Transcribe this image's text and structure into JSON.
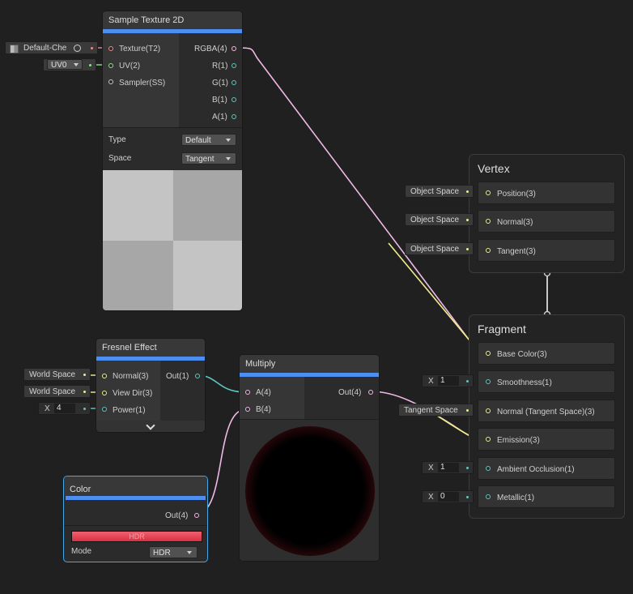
{
  "colors": {
    "background": "#202020",
    "accent_bar": "#4c8ff0",
    "texture_port": "#f08888",
    "uv_port": "#8fe08a",
    "vector1_port": "#5fc6c0",
    "vector3_port": "#f0ee8a",
    "vector4_port": "#f0b8e6",
    "hdr_color": "#e04a58"
  },
  "sample_texture": {
    "title": "Sample Texture 2D",
    "inputs": [
      "Texture(T2)",
      "UV(2)",
      "Sampler(SS)"
    ],
    "outputs": [
      "RGBA(4)",
      "R(1)",
      "G(1)",
      "B(1)",
      "A(1)"
    ],
    "type_label": "Type",
    "type_value": "Default",
    "space_label": "Space",
    "space_value": "Tangent",
    "texture_chip": "Default-Che",
    "uv_chip": "UV0"
  },
  "fresnel": {
    "title": "Fresnel Effect",
    "inputs": [
      "Normal(3)",
      "View Dir(3)",
      "Power(1)"
    ],
    "output": "Out(1)",
    "normal_chip": "World Space",
    "viewdir_chip": "World Space",
    "power_label": "X",
    "power_value": "4"
  },
  "multiply": {
    "title": "Multiply",
    "inputs": [
      "A(4)",
      "B(4)"
    ],
    "output": "Out(4)"
  },
  "color_node": {
    "title": "Color",
    "output": "Out(4)",
    "swatch_label": "HDR",
    "mode_label": "Mode",
    "mode_value": "HDR"
  },
  "vertex": {
    "title": "Vertex",
    "slots": [
      {
        "label": "Position(3)",
        "chip": "Object Space"
      },
      {
        "label": "Normal(3)",
        "chip": "Object Space"
      },
      {
        "label": "Tangent(3)",
        "chip": "Object Space"
      }
    ]
  },
  "fragment": {
    "title": "Fragment",
    "slots": [
      {
        "label": "Base Color(3)"
      },
      {
        "label": "Smoothness(1)",
        "x_label": "X",
        "x_value": "1"
      },
      {
        "label": "Normal (Tangent Space)(3)",
        "chip": "Tangent Space"
      },
      {
        "label": "Emission(3)"
      },
      {
        "label": "Ambient Occlusion(1)",
        "x_label": "X",
        "x_value": "1"
      },
      {
        "label": "Metallic(1)",
        "x_label": "X",
        "x_value": "0"
      }
    ]
  }
}
